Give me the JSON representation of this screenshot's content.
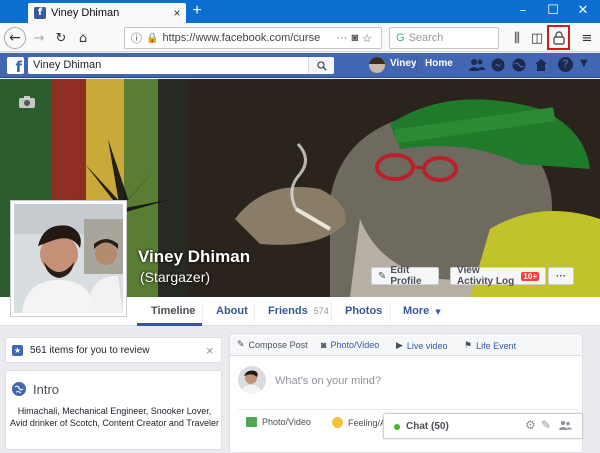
{
  "browser": {
    "tab_title": "Viney Dhiman",
    "tab_close": "×",
    "new_tab": "+",
    "url": "https://www.facebook.com/curse",
    "search_placeholder": "Search"
  },
  "facebook": {
    "logo": "f",
    "search_value": "Viney Dhiman",
    "nav_user": "Viney",
    "nav_home": "Home",
    "profile_name": "Viney Dhiman",
    "profile_alt_name": "(Stargazer)",
    "edit_profile": "Edit Profile",
    "view_activity": "View Activity Log",
    "activity_badge": "10+",
    "more_dots": "···",
    "tabs": {
      "timeline": "Timeline",
      "about": "About",
      "friends": "Friends",
      "friends_count": "574",
      "photos": "Photos",
      "more": "More"
    },
    "review": {
      "text": "561 items for you to review",
      "close": "×"
    },
    "intro": {
      "title": "Intro",
      "bio_line1": "Himachali, Mechanical Engineer, Snooker Lover,",
      "bio_line2": "Avid drinker of Scotch, Content Creator and Traveler"
    },
    "composer": {
      "compose_post": "Compose Post",
      "photo_video": "Photo/Video",
      "live_video": "Live video",
      "life_event": "Life Event",
      "placeholder": "What's on your mind?",
      "bottom_photo": "Photo/Video",
      "bottom_feeling": "Feeling/Ac"
    },
    "chat": {
      "label": "Chat (50)"
    }
  },
  "colors": {
    "browser_blue": "#0a6fd1",
    "facebook_blue": "#4267b2",
    "link_blue": "#365899",
    "highlight_red": "#d8191a",
    "chat_green": "#42b72a"
  }
}
